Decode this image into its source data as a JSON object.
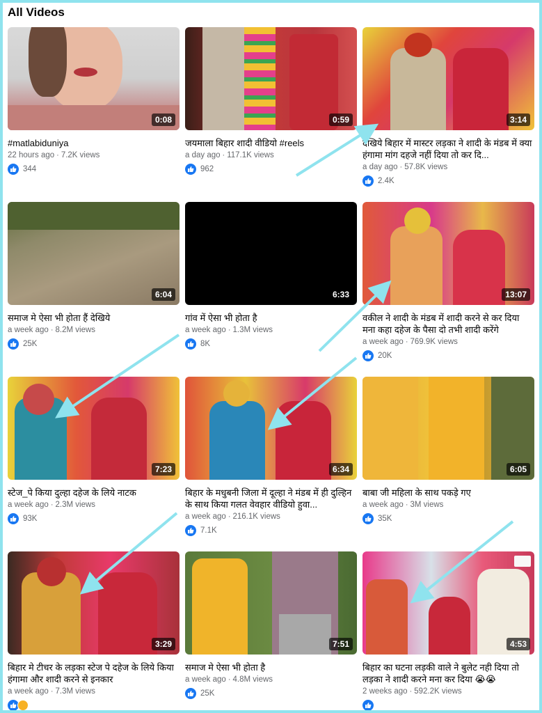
{
  "section_title": "All Videos",
  "colors": {
    "accent": "#1877f2",
    "frame": "#8fe3ee",
    "arrow": "#8fe3ee"
  },
  "videos": [
    {
      "title": "#matlabiduniya",
      "age": "22 hours ago",
      "views": "7.2K views",
      "likes": "344",
      "duration": "0:08"
    },
    {
      "title": "जयमाला बिहार शादी वीडियो #reels",
      "age": "a day ago",
      "views": "117.1K views",
      "likes": "962",
      "duration": "0:59"
    },
    {
      "title": "देखिये बिहार में मास्टर लड़का ने शादी के मंडब में क्या हंगामा मांग दहजे नहीं दिया तो कर दि...",
      "age": "a day ago",
      "views": "57.8K views",
      "likes": "2.4K",
      "duration": "3:14"
    },
    {
      "title": "समाज मे ऐसा भी होता हैं देखिये",
      "age": "a week ago",
      "views": "8.2M views",
      "likes": "25K",
      "duration": "6:04"
    },
    {
      "title": "गांव में ऐसा भी होता है",
      "age": "a week ago",
      "views": "1.3M views",
      "likes": "8K",
      "duration": "6:33"
    },
    {
      "title": "वकील ने शादी के मंडब में शादी करने से कर दिया मना कहा दहेज के पैसा दो तभी शादी करेंगे",
      "age": "a week ago",
      "views": "769.9K views",
      "likes": "20K",
      "duration": "13:07"
    },
    {
      "title": "स्टेज_पे किया दुल्हा दहेज के लिये नाटक",
      "age": "a week ago",
      "views": "2.3M views",
      "likes": "93K",
      "duration": "7:23"
    },
    {
      "title": "बिहार के मधुबनी जिला में दूल्हा ने मंडब में ही दुल्हिन के साथ किया गलत वेवहार वीडियो हुवा...",
      "age": "a week ago",
      "views": "216.1K views",
      "likes": "7.1K",
      "duration": "6:34"
    },
    {
      "title": "बाबा जी महिला के साथ पकड़े गए",
      "age": "a week ago",
      "views": "3M views",
      "likes": "35K",
      "duration": "6:05"
    },
    {
      "title": "बिहार मे टीचर के लड़का स्टेज पे दहेज के लिये किया हंगामा और शादी करने से इनकार",
      "age": "a week ago",
      "views": "7.3M views",
      "likes": "",
      "duration": "3:29"
    },
    {
      "title": "समाज मे ऐसा भी होता है",
      "age": "a week ago",
      "views": "4.8M views",
      "likes": "25K",
      "duration": "7:51"
    },
    {
      "title": "बिहार का घटना लड़की वाले ने बुलेट नही दिया तो लड़का ने शादी करने मना कर दिया 😭😭",
      "age": "2 weeks ago",
      "views": "592.2K views",
      "likes": "",
      "duration": "4:53"
    }
  ]
}
